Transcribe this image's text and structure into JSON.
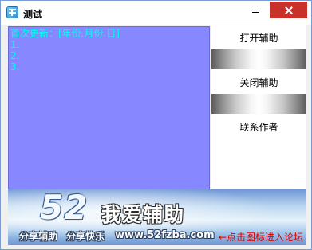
{
  "window": {
    "title": "测试"
  },
  "content": {
    "lines": [
      "首次更新：[年份.月份.日]",
      "1.",
      "2.",
      "3."
    ]
  },
  "buttons": {
    "open": "打开辅助",
    "close": "关闭辅助",
    "contact": "联系作者"
  },
  "banner": {
    "number": "52",
    "slogan": "我爱辅助",
    "footer_left": "分享辅助",
    "footer_mid": "分享快乐",
    "url": "www.52fzba.com",
    "link": "←点击图标进入论坛"
  },
  "colors": {
    "content_bg": "#8787ff",
    "content_text": "#00ffee",
    "close_button": "#c7312a",
    "link_text": "#e10000"
  }
}
